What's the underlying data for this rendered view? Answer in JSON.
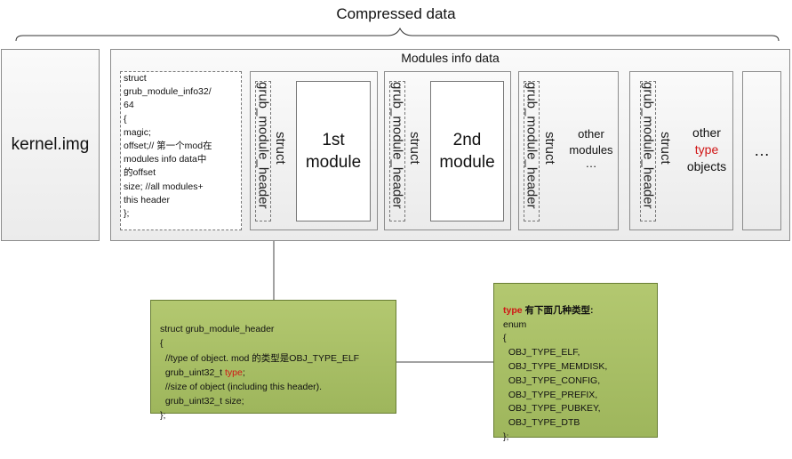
{
  "title": "Compressed data",
  "kernel_label": "kernel.img",
  "modules_info": {
    "title": "Modules info data",
    "struct_info_lines": [
      "struct",
      "grub_module_info32/",
      "64",
      "{",
      "magic;",
      "offset;// 第一个mod在",
      "modules info data中",
      "的offset",
      "size;  //all modules+",
      "this header",
      "};"
    ],
    "header_vertical_a": "grub_module_header",
    "header_vertical_b": "struct",
    "module_1_line1": "1st",
    "module_1_line2": "module",
    "module_2_line1": "2nd",
    "module_2_line2": "module",
    "other_modules_line1": "other",
    "other_modules_line2": "modules",
    "other_modules_line3": "…",
    "other_type_line1": "other",
    "other_type_line2": "type",
    "other_type_line3": "objects",
    "ellipsis": "…"
  },
  "header_note": {
    "line1": "struct grub_module_header",
    "line2": "{",
    "line3": "  //type of object. mod 的类型是OBJ_TYPE_ELF",
    "line4_pre": "  grub_uint32_t ",
    "line4_red": "type",
    "line4_post": ";",
    "line5": "  //size of object (including this header).",
    "line6": "  grub_uint32_t size;",
    "line7": "};"
  },
  "type_note": {
    "title_red": "type",
    "title_rest": " 有下面几种类型:",
    "lines": [
      "enum",
      "{",
      "  OBJ_TYPE_ELF,",
      "  OBJ_TYPE_MEMDISK,",
      "  OBJ_TYPE_CONFIG,",
      "  OBJ_TYPE_PREFIX,",
      "  OBJ_TYPE_PUBKEY,",
      "  OBJ_TYPE_DTB",
      "};"
    ]
  },
  "colors": {
    "note_green": "#a6bc62",
    "highlight_red": "#d01515",
    "box_border": "#8c8c8c"
  }
}
